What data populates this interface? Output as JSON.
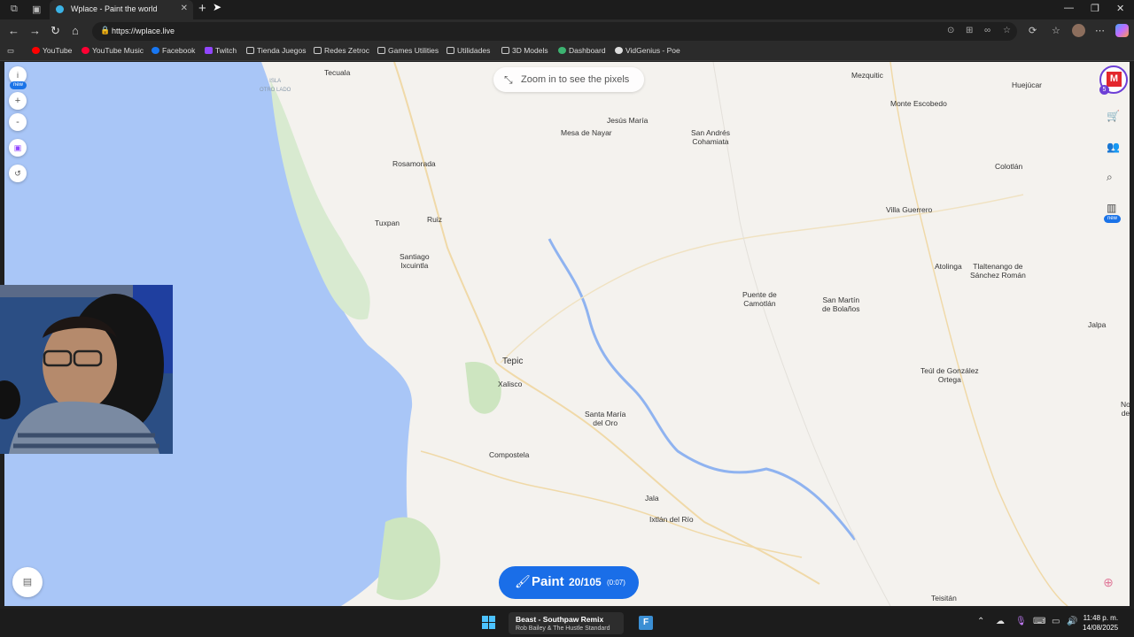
{
  "browser": {
    "tab_title": "Wplace - Paint the world",
    "url": "https://wplace.live",
    "bookmarks": [
      {
        "label": "YouTube",
        "icon": "youtube-icon"
      },
      {
        "label": "YouTube Music",
        "icon": "youtube-music-icon"
      },
      {
        "label": "Facebook",
        "icon": "facebook-icon"
      },
      {
        "label": "Twitch",
        "icon": "twitch-icon"
      },
      {
        "label": "Tienda Juegos",
        "icon": "folder-icon"
      },
      {
        "label": "Redes Zetroc",
        "icon": "folder-icon"
      },
      {
        "label": "Games Utilities",
        "icon": "folder-icon"
      },
      {
        "label": "Utilidades",
        "icon": "folder-icon"
      },
      {
        "label": "3D Models",
        "icon": "folder-icon"
      },
      {
        "label": "Dashboard",
        "icon": "dashboard-icon"
      },
      {
        "label": "VidGenius - Poe",
        "icon": "poe-icon"
      }
    ]
  },
  "map": {
    "zoom_hint": "Zoom in to see the pixels",
    "left_controls": {
      "info_badge": "new"
    },
    "right_controls": {
      "badge_count": "5",
      "leaderboard_badge": "new"
    },
    "places": {
      "tecuala": "Tecuala",
      "isla": "ISLA\nOTRO LADO",
      "jesus_maria": "Jesús María",
      "mesa_de_nayar": "Mesa de Nayar",
      "san_andres": "San Andrés\nCohamiata",
      "mezquitic": "Mezquitic",
      "huejucar": "Huejúcar",
      "monte_escobedo": "Monte Escobedo",
      "colotlan": "Colotlán",
      "rosamorada": "Rosamorada",
      "villa_guerrero": "Villa Guerrero",
      "tuxpan": "Tuxpan",
      "ruiz": "Ruiz",
      "santiago": "Santiago\nIxcuintla",
      "atolinga": "Atolinga",
      "tlaltenango": "Tlaltenango de\nSánchez Román",
      "puente_camotlan": "Puente de\nCamotlán",
      "san_martin": "San Martín\nde Bolaños",
      "jalpa": "Jalpa",
      "tepic": "Tepic",
      "xalisco": "Xalisco",
      "teul": "Teúl de González\nOrtega",
      "santa_maria": "Santa María\ndel Oro",
      "no": "No\nde",
      "compostela": "Compostela",
      "jala": "Jala",
      "ixtlan": "Ixtlán del Río",
      "teisitan": "Teisitán"
    },
    "paint_button": {
      "label": "Paint",
      "count": "20/105",
      "timer": "(0:07)"
    }
  },
  "taskbar": {
    "media_title": "Beast - Southpaw Remix",
    "media_subtitle": "Rob Bailey & The Hustle Standard",
    "time": "11:48 p. m.",
    "date": "14/08/2025"
  },
  "colors": {
    "accent": "#1a6ee8",
    "sea": "#a9c6f7",
    "land": "#f4f2ee"
  }
}
